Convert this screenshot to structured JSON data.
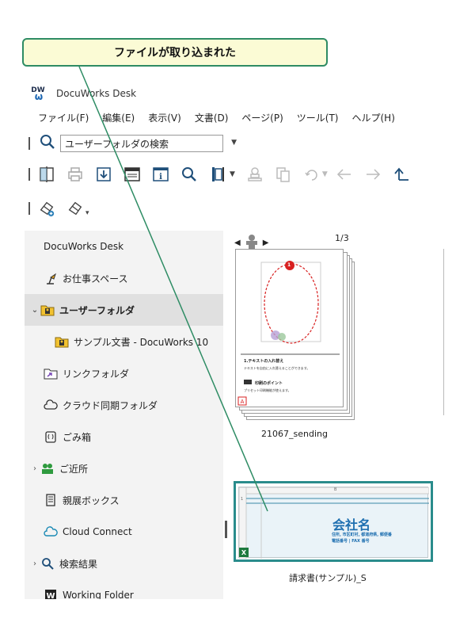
{
  "callout": {
    "text": "ファイルが取り込まれた"
  },
  "window": {
    "logo_top": "DW",
    "title": "DocuWorks Desk"
  },
  "menu": [
    "ファイル(F)",
    "編集(E)",
    "表示(V)",
    "文書(D)",
    "ページ(P)",
    "ツール(T)",
    "ヘルプ(H)"
  ],
  "search": {
    "scope": "ユーザーフォルダの検索"
  },
  "sidebar": {
    "items": [
      {
        "label": "DocuWorks Desk",
        "icon": "none"
      },
      {
        "label": "お仕事スペース",
        "icon": "desk-lamp-icon"
      },
      {
        "label": "ユーザーフォルダ",
        "icon": "user-folder-icon",
        "expanded": true,
        "selected": true
      },
      {
        "label": "サンプル文書 - DocuWorks 10",
        "icon": "user-folder-icon"
      },
      {
        "label": "リンクフォルダ",
        "icon": "link-folder-icon"
      },
      {
        "label": "クラウド同期フォルダ",
        "icon": "cloud-icon"
      },
      {
        "label": "ごみ箱",
        "icon": "trash-icon"
      },
      {
        "label": "ご近所",
        "icon": "people-icon"
      },
      {
        "label": "親展ボックス",
        "icon": "mailbox-icon"
      },
      {
        "label": "Cloud Connect",
        "icon": "cloud-connect-icon"
      },
      {
        "label": "検索結果",
        "icon": "search-icon"
      },
      {
        "label": "Working Folder",
        "icon": "working-folder-icon"
      }
    ]
  },
  "documents": [
    {
      "name": "21067_sending",
      "page_indicator": "1/3",
      "badge": "1",
      "heading1": "1.テキストの入れ替え",
      "body1": "テキストを自由に入れ替えることができます。",
      "heading2": "印刷のポイント",
      "body2": "プリセット印刷機能が使えます。"
    },
    {
      "name": "請求書(サンプル)_S",
      "company": "会社名",
      "address_line": "住所, 市区町村, 都道府県, 郵便番",
      "phone_line": "電話番号 | FAX 番号",
      "col_label": "B",
      "row_label": "1"
    }
  ],
  "colors": {
    "accent": "#2e8c64",
    "selection": "#2a8c8c",
    "invoice_blue": "#1e6fb0"
  }
}
